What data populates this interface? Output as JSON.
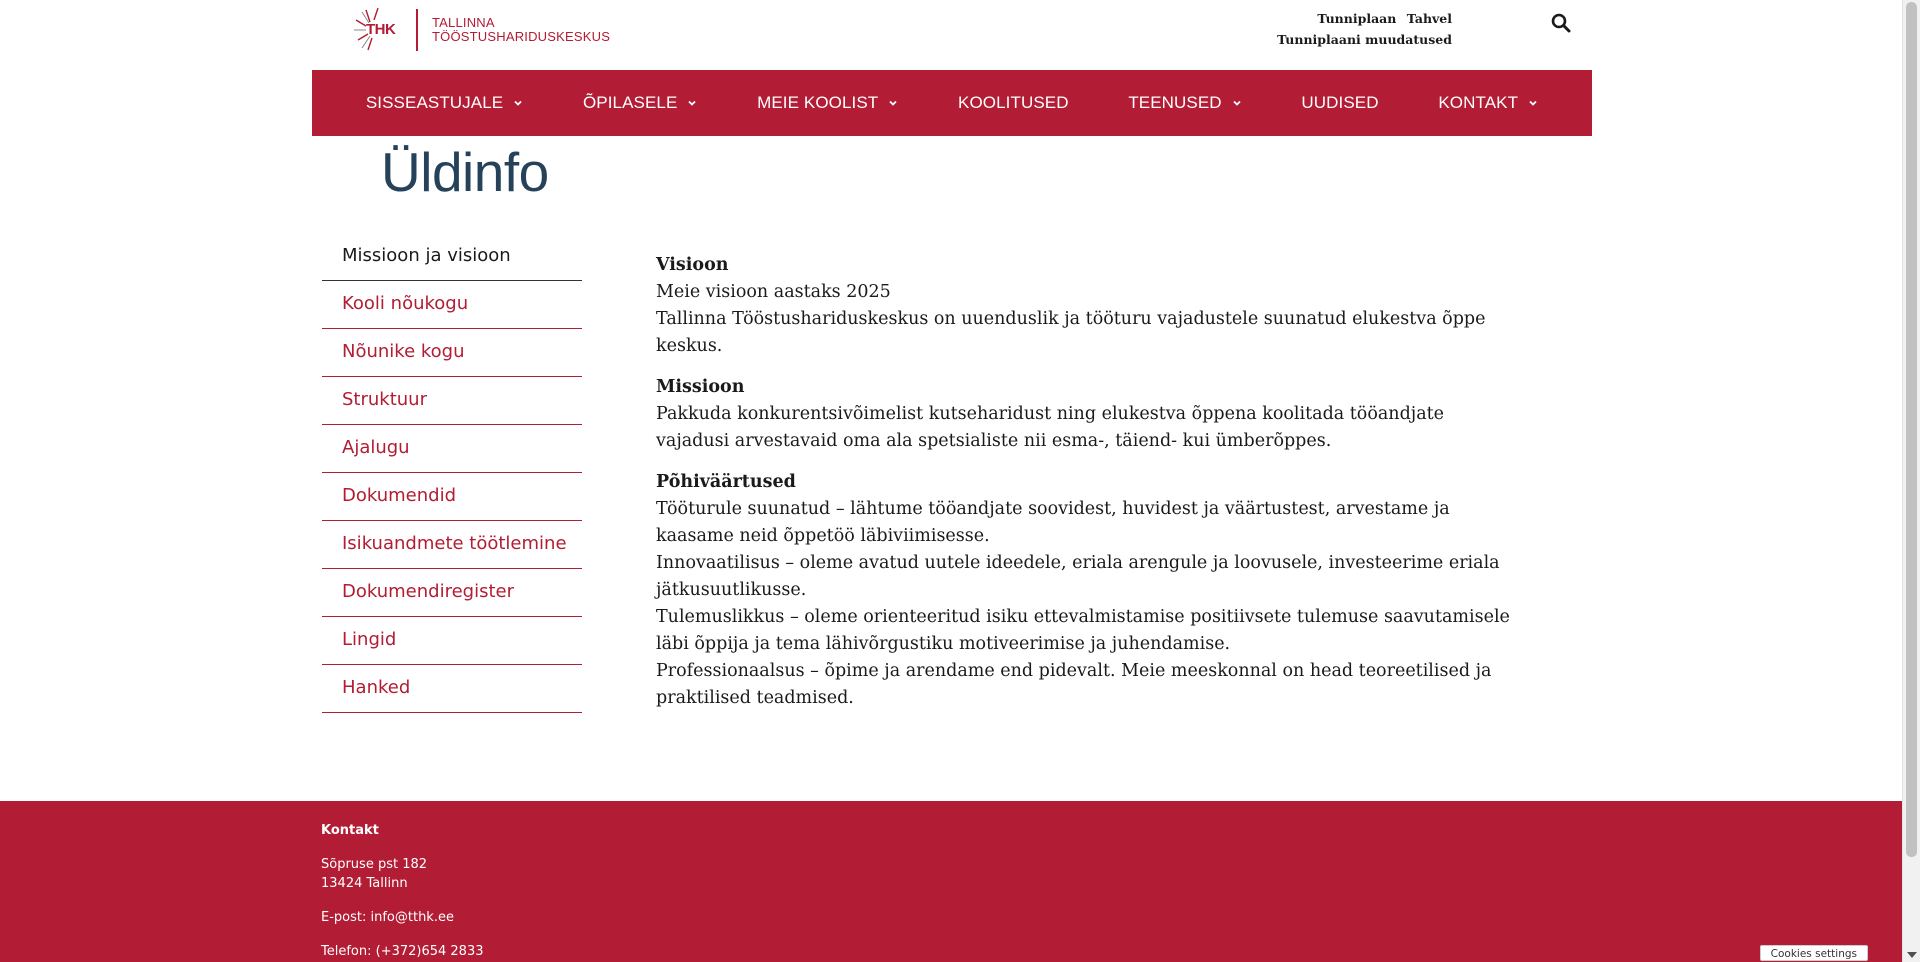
{
  "logo": {
    "abbr": "THK",
    "line1": "TALLINNA",
    "line2": "TÖÖSTUSHARIDUSKESKUS"
  },
  "toplinks": {
    "schedule": "Tunniplaan",
    "tahvel": "Tahvel",
    "changes": "Tunniplaani muudatused"
  },
  "nav": [
    {
      "label": "SISSEASTUJALE",
      "dropdown": true
    },
    {
      "label": "ÕPILASELE",
      "dropdown": true
    },
    {
      "label": "MEIE KOOLIST",
      "dropdown": true
    },
    {
      "label": "KOOLITUSED",
      "dropdown": false
    },
    {
      "label": "TEENUSED",
      "dropdown": true
    },
    {
      "label": "UUDISED",
      "dropdown": false
    },
    {
      "label": "KONTAKT",
      "dropdown": true
    }
  ],
  "page_title": "Üldinfo",
  "sidebar": [
    {
      "label": "Missioon ja visioon",
      "active": true
    },
    {
      "label": "Kooli nõukogu",
      "active": false
    },
    {
      "label": "Nõunike kogu",
      "active": false
    },
    {
      "label": "Struktuur",
      "active": false
    },
    {
      "label": "Ajalugu",
      "active": false
    },
    {
      "label": "Dokumendid",
      "active": false
    },
    {
      "label": "Isikuandmete töötlemine",
      "active": false
    },
    {
      "label": "Dokumendiregister",
      "active": false
    },
    {
      "label": "Lingid",
      "active": false
    },
    {
      "label": "Hanked",
      "active": false
    }
  ],
  "content": {
    "vision_heading": "Visioon",
    "vision_lines": [
      "Meie visioon aastaks 2025",
      "Tallinna Tööstushariduskeskus on uuenduslik ja tööturu vajadustele suunatud elukestva õppe keskus."
    ],
    "mission_heading": "Missioon",
    "mission_text": "Pakkuda konkurentsivõimelist kutseharidust ning elukestva õppena koolitada tööandjate vajadusi arvestavaid oma ala spetsialiste nii esma-, täiend- kui ümberõppes.",
    "values_heading": "Põhiväärtused",
    "values": [
      "Tööturule suunatud – lähtume tööandjate soovidest, huvidest ja väärtustest, arvestame ja kaasame neid õppetöö läbiviimisesse.",
      "Innovaatilisus – oleme avatud uutele ideedele, eriala arengule ja loovusele, investeerime eriala jätkusuutlikusse.",
      "Tulemuslikkus – oleme orienteeritud isiku ettevalmistamise positiivsete tulemuse saavutamisele läbi õppija ja tema lähivõrgustiku motiveerimise ja juhendamise.",
      "Professionaalsus – õpime ja arendame end pidevalt. Meie meeskonnal on head teoreetilised ja praktilised teadmised."
    ]
  },
  "footer": {
    "heading": "Kontakt",
    "street": "Sõpruse pst 182",
    "city": "13424 Tallinn",
    "email": "E-post: info@tthk.ee",
    "phone": "Telefon: (+372)654 2833"
  },
  "cookie_button": "Cookies settings",
  "colors": {
    "brand_red": "#b21c34",
    "title_blue": "#26425a"
  }
}
